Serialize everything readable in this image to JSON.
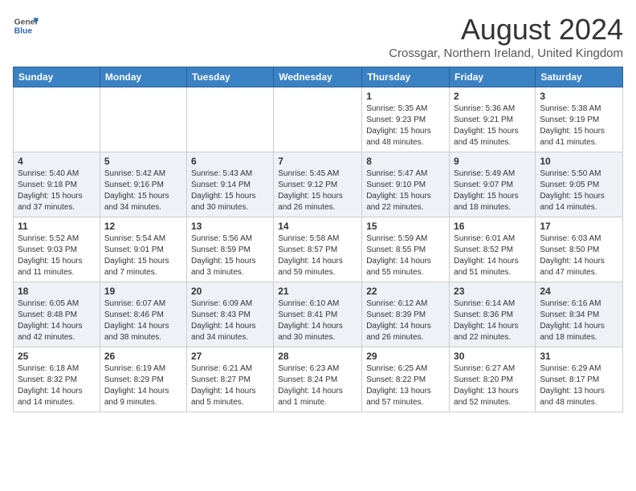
{
  "logo": {
    "general": "General",
    "blue": "Blue"
  },
  "title": "August 2024",
  "location": "Crossgar, Northern Ireland, United Kingdom",
  "days_of_week": [
    "Sunday",
    "Monday",
    "Tuesday",
    "Wednesday",
    "Thursday",
    "Friday",
    "Saturday"
  ],
  "weeks": [
    [
      {
        "day": "",
        "info": ""
      },
      {
        "day": "",
        "info": ""
      },
      {
        "day": "",
        "info": ""
      },
      {
        "day": "",
        "info": ""
      },
      {
        "day": "1",
        "info": "Sunrise: 5:35 AM\nSunset: 9:23 PM\nDaylight: 15 hours\nand 48 minutes."
      },
      {
        "day": "2",
        "info": "Sunrise: 5:36 AM\nSunset: 9:21 PM\nDaylight: 15 hours\nand 45 minutes."
      },
      {
        "day": "3",
        "info": "Sunrise: 5:38 AM\nSunset: 9:19 PM\nDaylight: 15 hours\nand 41 minutes."
      }
    ],
    [
      {
        "day": "4",
        "info": "Sunrise: 5:40 AM\nSunset: 9:18 PM\nDaylight: 15 hours\nand 37 minutes."
      },
      {
        "day": "5",
        "info": "Sunrise: 5:42 AM\nSunset: 9:16 PM\nDaylight: 15 hours\nand 34 minutes."
      },
      {
        "day": "6",
        "info": "Sunrise: 5:43 AM\nSunset: 9:14 PM\nDaylight: 15 hours\nand 30 minutes."
      },
      {
        "day": "7",
        "info": "Sunrise: 5:45 AM\nSunset: 9:12 PM\nDaylight: 15 hours\nand 26 minutes."
      },
      {
        "day": "8",
        "info": "Sunrise: 5:47 AM\nSunset: 9:10 PM\nDaylight: 15 hours\nand 22 minutes."
      },
      {
        "day": "9",
        "info": "Sunrise: 5:49 AM\nSunset: 9:07 PM\nDaylight: 15 hours\nand 18 minutes."
      },
      {
        "day": "10",
        "info": "Sunrise: 5:50 AM\nSunset: 9:05 PM\nDaylight: 15 hours\nand 14 minutes."
      }
    ],
    [
      {
        "day": "11",
        "info": "Sunrise: 5:52 AM\nSunset: 9:03 PM\nDaylight: 15 hours\nand 11 minutes."
      },
      {
        "day": "12",
        "info": "Sunrise: 5:54 AM\nSunset: 9:01 PM\nDaylight: 15 hours\nand 7 minutes."
      },
      {
        "day": "13",
        "info": "Sunrise: 5:56 AM\nSunset: 8:59 PM\nDaylight: 15 hours\nand 3 minutes."
      },
      {
        "day": "14",
        "info": "Sunrise: 5:58 AM\nSunset: 8:57 PM\nDaylight: 14 hours\nand 59 minutes."
      },
      {
        "day": "15",
        "info": "Sunrise: 5:59 AM\nSunset: 8:55 PM\nDaylight: 14 hours\nand 55 minutes."
      },
      {
        "day": "16",
        "info": "Sunrise: 6:01 AM\nSunset: 8:52 PM\nDaylight: 14 hours\nand 51 minutes."
      },
      {
        "day": "17",
        "info": "Sunrise: 6:03 AM\nSunset: 8:50 PM\nDaylight: 14 hours\nand 47 minutes."
      }
    ],
    [
      {
        "day": "18",
        "info": "Sunrise: 6:05 AM\nSunset: 8:48 PM\nDaylight: 14 hours\nand 42 minutes."
      },
      {
        "day": "19",
        "info": "Sunrise: 6:07 AM\nSunset: 8:46 PM\nDaylight: 14 hours\nand 38 minutes."
      },
      {
        "day": "20",
        "info": "Sunrise: 6:09 AM\nSunset: 8:43 PM\nDaylight: 14 hours\nand 34 minutes."
      },
      {
        "day": "21",
        "info": "Sunrise: 6:10 AM\nSunset: 8:41 PM\nDaylight: 14 hours\nand 30 minutes."
      },
      {
        "day": "22",
        "info": "Sunrise: 6:12 AM\nSunset: 8:39 PM\nDaylight: 14 hours\nand 26 minutes."
      },
      {
        "day": "23",
        "info": "Sunrise: 6:14 AM\nSunset: 8:36 PM\nDaylight: 14 hours\nand 22 minutes."
      },
      {
        "day": "24",
        "info": "Sunrise: 6:16 AM\nSunset: 8:34 PM\nDaylight: 14 hours\nand 18 minutes."
      }
    ],
    [
      {
        "day": "25",
        "info": "Sunrise: 6:18 AM\nSunset: 8:32 PM\nDaylight: 14 hours\nand 14 minutes."
      },
      {
        "day": "26",
        "info": "Sunrise: 6:19 AM\nSunset: 8:29 PM\nDaylight: 14 hours\nand 9 minutes."
      },
      {
        "day": "27",
        "info": "Sunrise: 6:21 AM\nSunset: 8:27 PM\nDaylight: 14 hours\nand 5 minutes."
      },
      {
        "day": "28",
        "info": "Sunrise: 6:23 AM\nSunset: 8:24 PM\nDaylight: 14 hours\nand 1 minute."
      },
      {
        "day": "29",
        "info": "Sunrise: 6:25 AM\nSunset: 8:22 PM\nDaylight: 13 hours\nand 57 minutes."
      },
      {
        "day": "30",
        "info": "Sunrise: 6:27 AM\nSunset: 8:20 PM\nDaylight: 13 hours\nand 52 minutes."
      },
      {
        "day": "31",
        "info": "Sunrise: 6:29 AM\nSunset: 8:17 PM\nDaylight: 13 hours\nand 48 minutes."
      }
    ]
  ]
}
